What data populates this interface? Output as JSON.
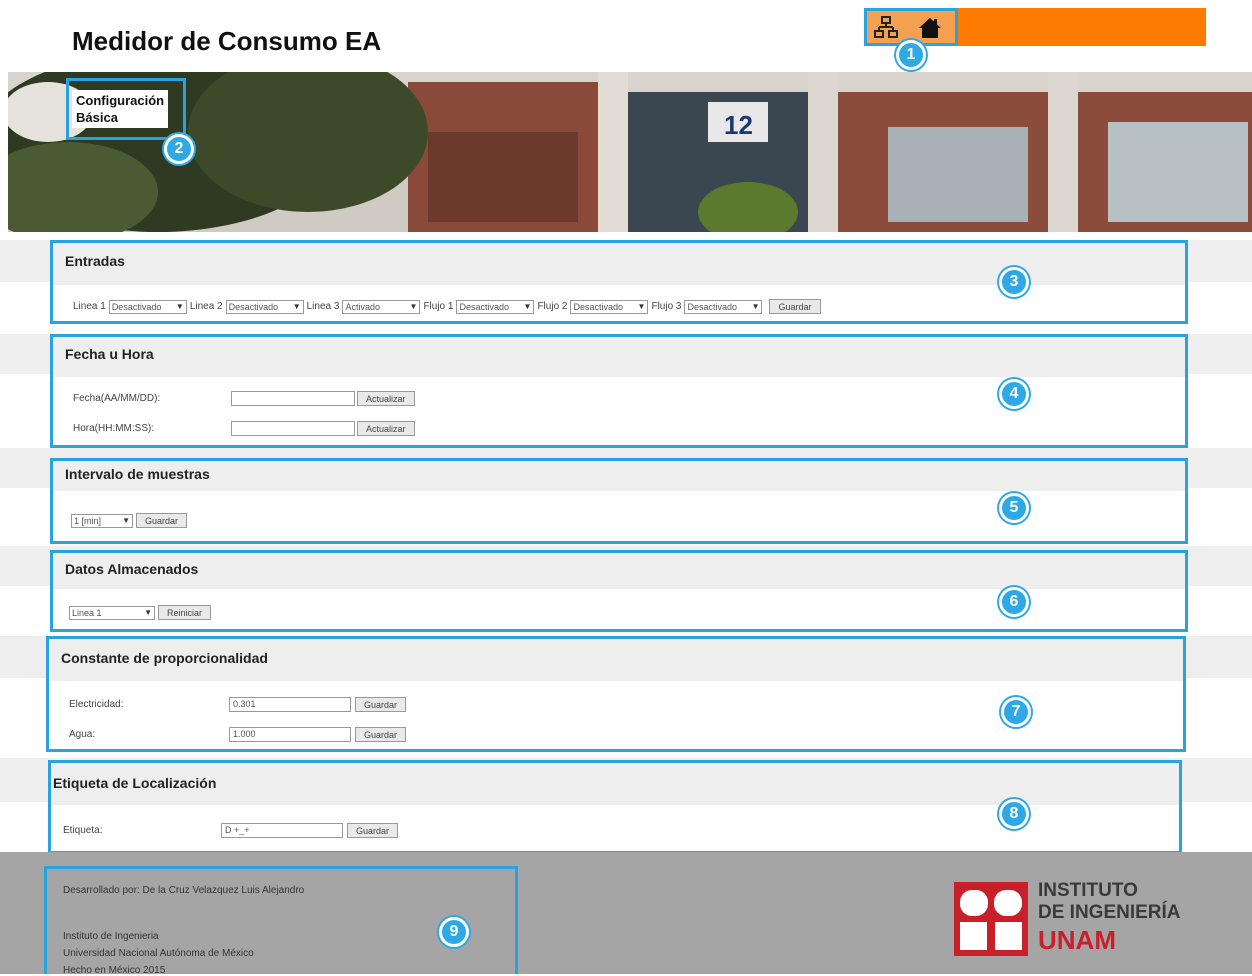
{
  "app": {
    "title": "Medidor de Consumo EA"
  },
  "callouts": [
    "1",
    "2",
    "3",
    "4",
    "5",
    "6",
    "7",
    "8",
    "9"
  ],
  "toolbar": {
    "icons": [
      "network-icon",
      "home-icon"
    ]
  },
  "hero": {
    "nav_label_line1": "Configuración",
    "nav_label_line2": "Básica",
    "building_number": "12"
  },
  "sections": {
    "entradas": {
      "title": "Entradas",
      "fields": [
        {
          "label": "Linea 1",
          "value": "Desactivado"
        },
        {
          "label": "Linea 2",
          "value": "Desactivado"
        },
        {
          "label": "Linea 3",
          "value": "Activado"
        },
        {
          "label": "Flujo 1",
          "value": "Desactivado"
        },
        {
          "label": "Flujo 2",
          "value": "Desactivado"
        },
        {
          "label": "Flujo 3",
          "value": "Desactivado"
        }
      ],
      "button": "Guardar"
    },
    "fecha": {
      "title": "Fecha u Hora",
      "date_label": "Fecha(AA/MM/DD):",
      "time_label": "Hora(HH:MM:SS):",
      "date_value": "",
      "time_value": "",
      "button": "Actualizar"
    },
    "intervalo": {
      "title": "Intervalo de muestras",
      "value": "1 [min]",
      "button": "Guardar"
    },
    "datos": {
      "title": "Datos Almacenados",
      "value": "Linea 1",
      "button": "Reiniciar"
    },
    "constante": {
      "title": "Constante de proporcionalidad",
      "electricidad_label": "Electricidad:",
      "electricidad_value": "0.301",
      "agua_label": "Agua:",
      "agua_value": "1.000",
      "button": "Guardar"
    },
    "etiqueta": {
      "title": "Etiqueta de Localización",
      "label": "Etiqueta:",
      "value": "D +_+",
      "button": "Guardar"
    }
  },
  "footer": {
    "developer": "Desarrollado por: De la Cruz Velazquez Luis Alejandro",
    "line1": "Instituto de Ingenieria",
    "line2": "Universidad Nacional Autónoma de México",
    "line3": "Hecho en México 2015",
    "logo_line1": "INSTITUTO",
    "logo_line2": "DE INGENIERÍA",
    "logo_line3": "UNAM"
  },
  "colors": {
    "accent_orange": "#ff7b00",
    "annotation_blue": "#29a3e0",
    "unam_red": "#c8202b"
  }
}
